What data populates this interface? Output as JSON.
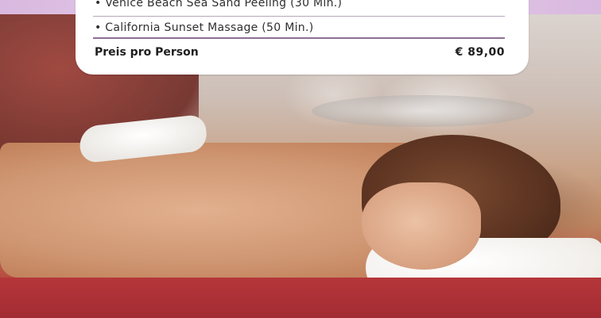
{
  "package": {
    "items": [
      "• Venice Beach Sea Sand Peeling (30 Min.)",
      "• California Sunset Massage (50 Min.)"
    ],
    "price_label": "Preis pro Person",
    "price_value": "€  89,00"
  },
  "colors": {
    "accent_purple": "#8e6f95",
    "band_purple": "#d9b9df"
  }
}
